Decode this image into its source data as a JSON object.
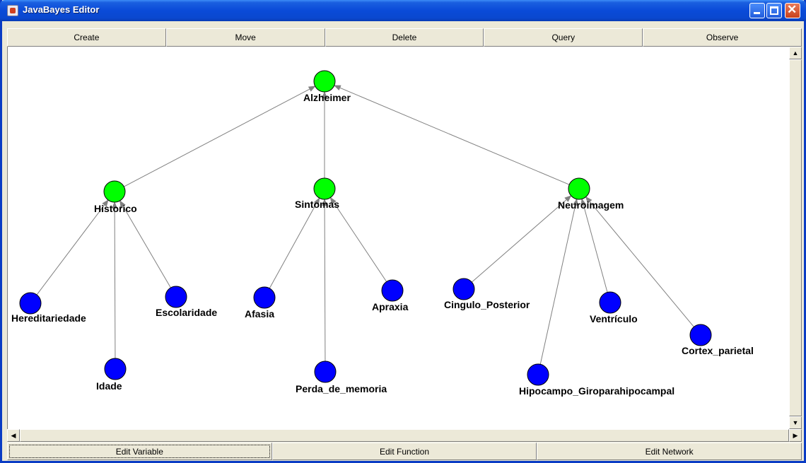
{
  "window": {
    "title": "JavaBayes Editor"
  },
  "toolbar": [
    "Create",
    "Move",
    "Delete",
    "Query",
    "Observe"
  ],
  "bottom_buttons": [
    "Edit Variable",
    "Edit Function",
    "Edit Network"
  ],
  "colors": {
    "root_node": "#00ff00",
    "leaf_node": "#0000ff",
    "titlebar": "#0a4ad8",
    "edge": "#808080"
  },
  "network": {
    "nodes": [
      {
        "id": "alzheimer",
        "label": "Alzheimer",
        "type": "green"
      },
      {
        "id": "historico",
        "label": "Historico",
        "type": "green"
      },
      {
        "id": "sintomas",
        "label": "Sintomas",
        "type": "green"
      },
      {
        "id": "neuroimagem",
        "label": "Neuroimagem",
        "type": "green"
      },
      {
        "id": "hereditariedade",
        "label": "Hereditariedade",
        "type": "blue"
      },
      {
        "id": "idade",
        "label": "Idade",
        "type": "blue"
      },
      {
        "id": "escolaridade",
        "label": "Escolaridade",
        "type": "blue"
      },
      {
        "id": "afasia",
        "label": "Afasia",
        "type": "blue"
      },
      {
        "id": "perda",
        "label": "Perda_de_memoria",
        "type": "blue"
      },
      {
        "id": "apraxia",
        "label": "Apraxia",
        "type": "blue"
      },
      {
        "id": "cingulo",
        "label": "Cingulo_Posterior",
        "type": "blue"
      },
      {
        "id": "hipocampo",
        "label": "Hipocampo_Giroparahipocampal",
        "type": "blue"
      },
      {
        "id": "ventriculo",
        "label": "Ventrículo",
        "type": "blue"
      },
      {
        "id": "cortex",
        "label": "Cortex_parietal",
        "type": "blue"
      }
    ],
    "edges": [
      [
        "historico",
        "alzheimer"
      ],
      [
        "sintomas",
        "alzheimer"
      ],
      [
        "neuroimagem",
        "alzheimer"
      ],
      [
        "hereditariedade",
        "historico"
      ],
      [
        "idade",
        "historico"
      ],
      [
        "escolaridade",
        "historico"
      ],
      [
        "afasia",
        "sintomas"
      ],
      [
        "perda",
        "sintomas"
      ],
      [
        "apraxia",
        "sintomas"
      ],
      [
        "cingulo",
        "neuroimagem"
      ],
      [
        "hipocampo",
        "neuroimagem"
      ],
      [
        "ventriculo",
        "neuroimagem"
      ],
      [
        "cortex",
        "neuroimagem"
      ]
    ]
  }
}
